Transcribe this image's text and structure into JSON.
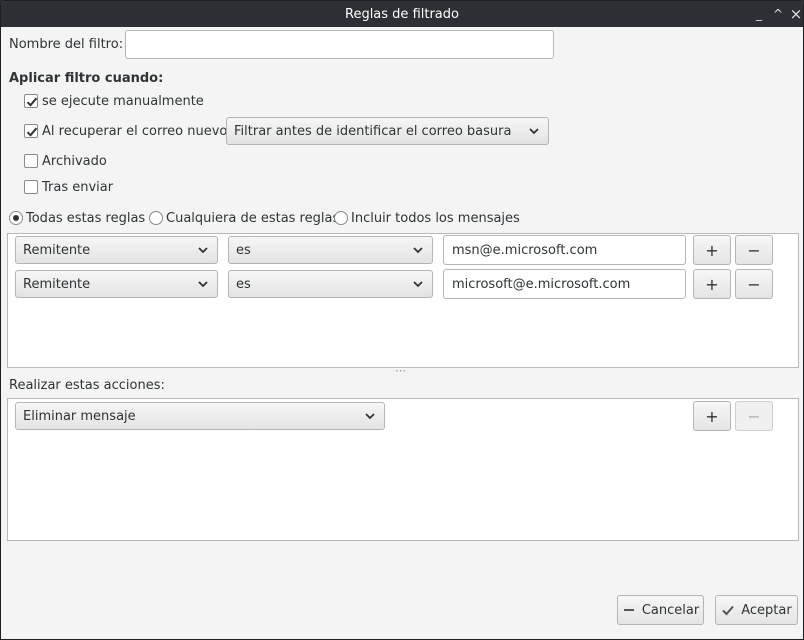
{
  "window": {
    "title": "Reglas de filtrado",
    "controls": {
      "minimize": "_",
      "maximize": "^",
      "close": "×"
    }
  },
  "filter_name": {
    "label": "Nombre del filtro:",
    "value": ""
  },
  "apply_section": {
    "heading": "Aplicar filtro cuando:",
    "options": [
      {
        "label": "se ejecute manualmente",
        "checked": true
      },
      {
        "label": "Al recuperar el correo nuevo:",
        "checked": true
      },
      {
        "label": "Archivado",
        "checked": false
      },
      {
        "label": "Tras enviar",
        "checked": false
      }
    ],
    "fetch_timing": "Filtrar antes de identificar el correo basura"
  },
  "match_mode": {
    "options": [
      {
        "label": "Todas estas reglas",
        "selected": true
      },
      {
        "label": "Cualquiera de estas reglas",
        "selected": false
      },
      {
        "label": "Incluir todos los mensajes",
        "selected": false
      }
    ]
  },
  "rules": [
    {
      "field": "Remitente",
      "operator": "es",
      "value": "msn@e.microsoft.com",
      "add": "+",
      "remove": "−"
    },
    {
      "field": "Remitente",
      "operator": "es",
      "value": "microsoft@e.microsoft.com",
      "add": "+",
      "remove": "−"
    }
  ],
  "splitter_handle": "⋯",
  "actions": {
    "heading": "Realizar estas acciones:",
    "items": [
      {
        "action": "Eliminar mensaje",
        "add": "+",
        "remove": "−"
      }
    ]
  },
  "footer": {
    "cancel_label": "Cancelar",
    "accept_label": "Aceptar"
  },
  "colors": {
    "titlebar": "#2c2f33",
    "window_bg": "#f4f4f4",
    "panel_bg": "#ffffff",
    "border": "#b5b5b5"
  }
}
